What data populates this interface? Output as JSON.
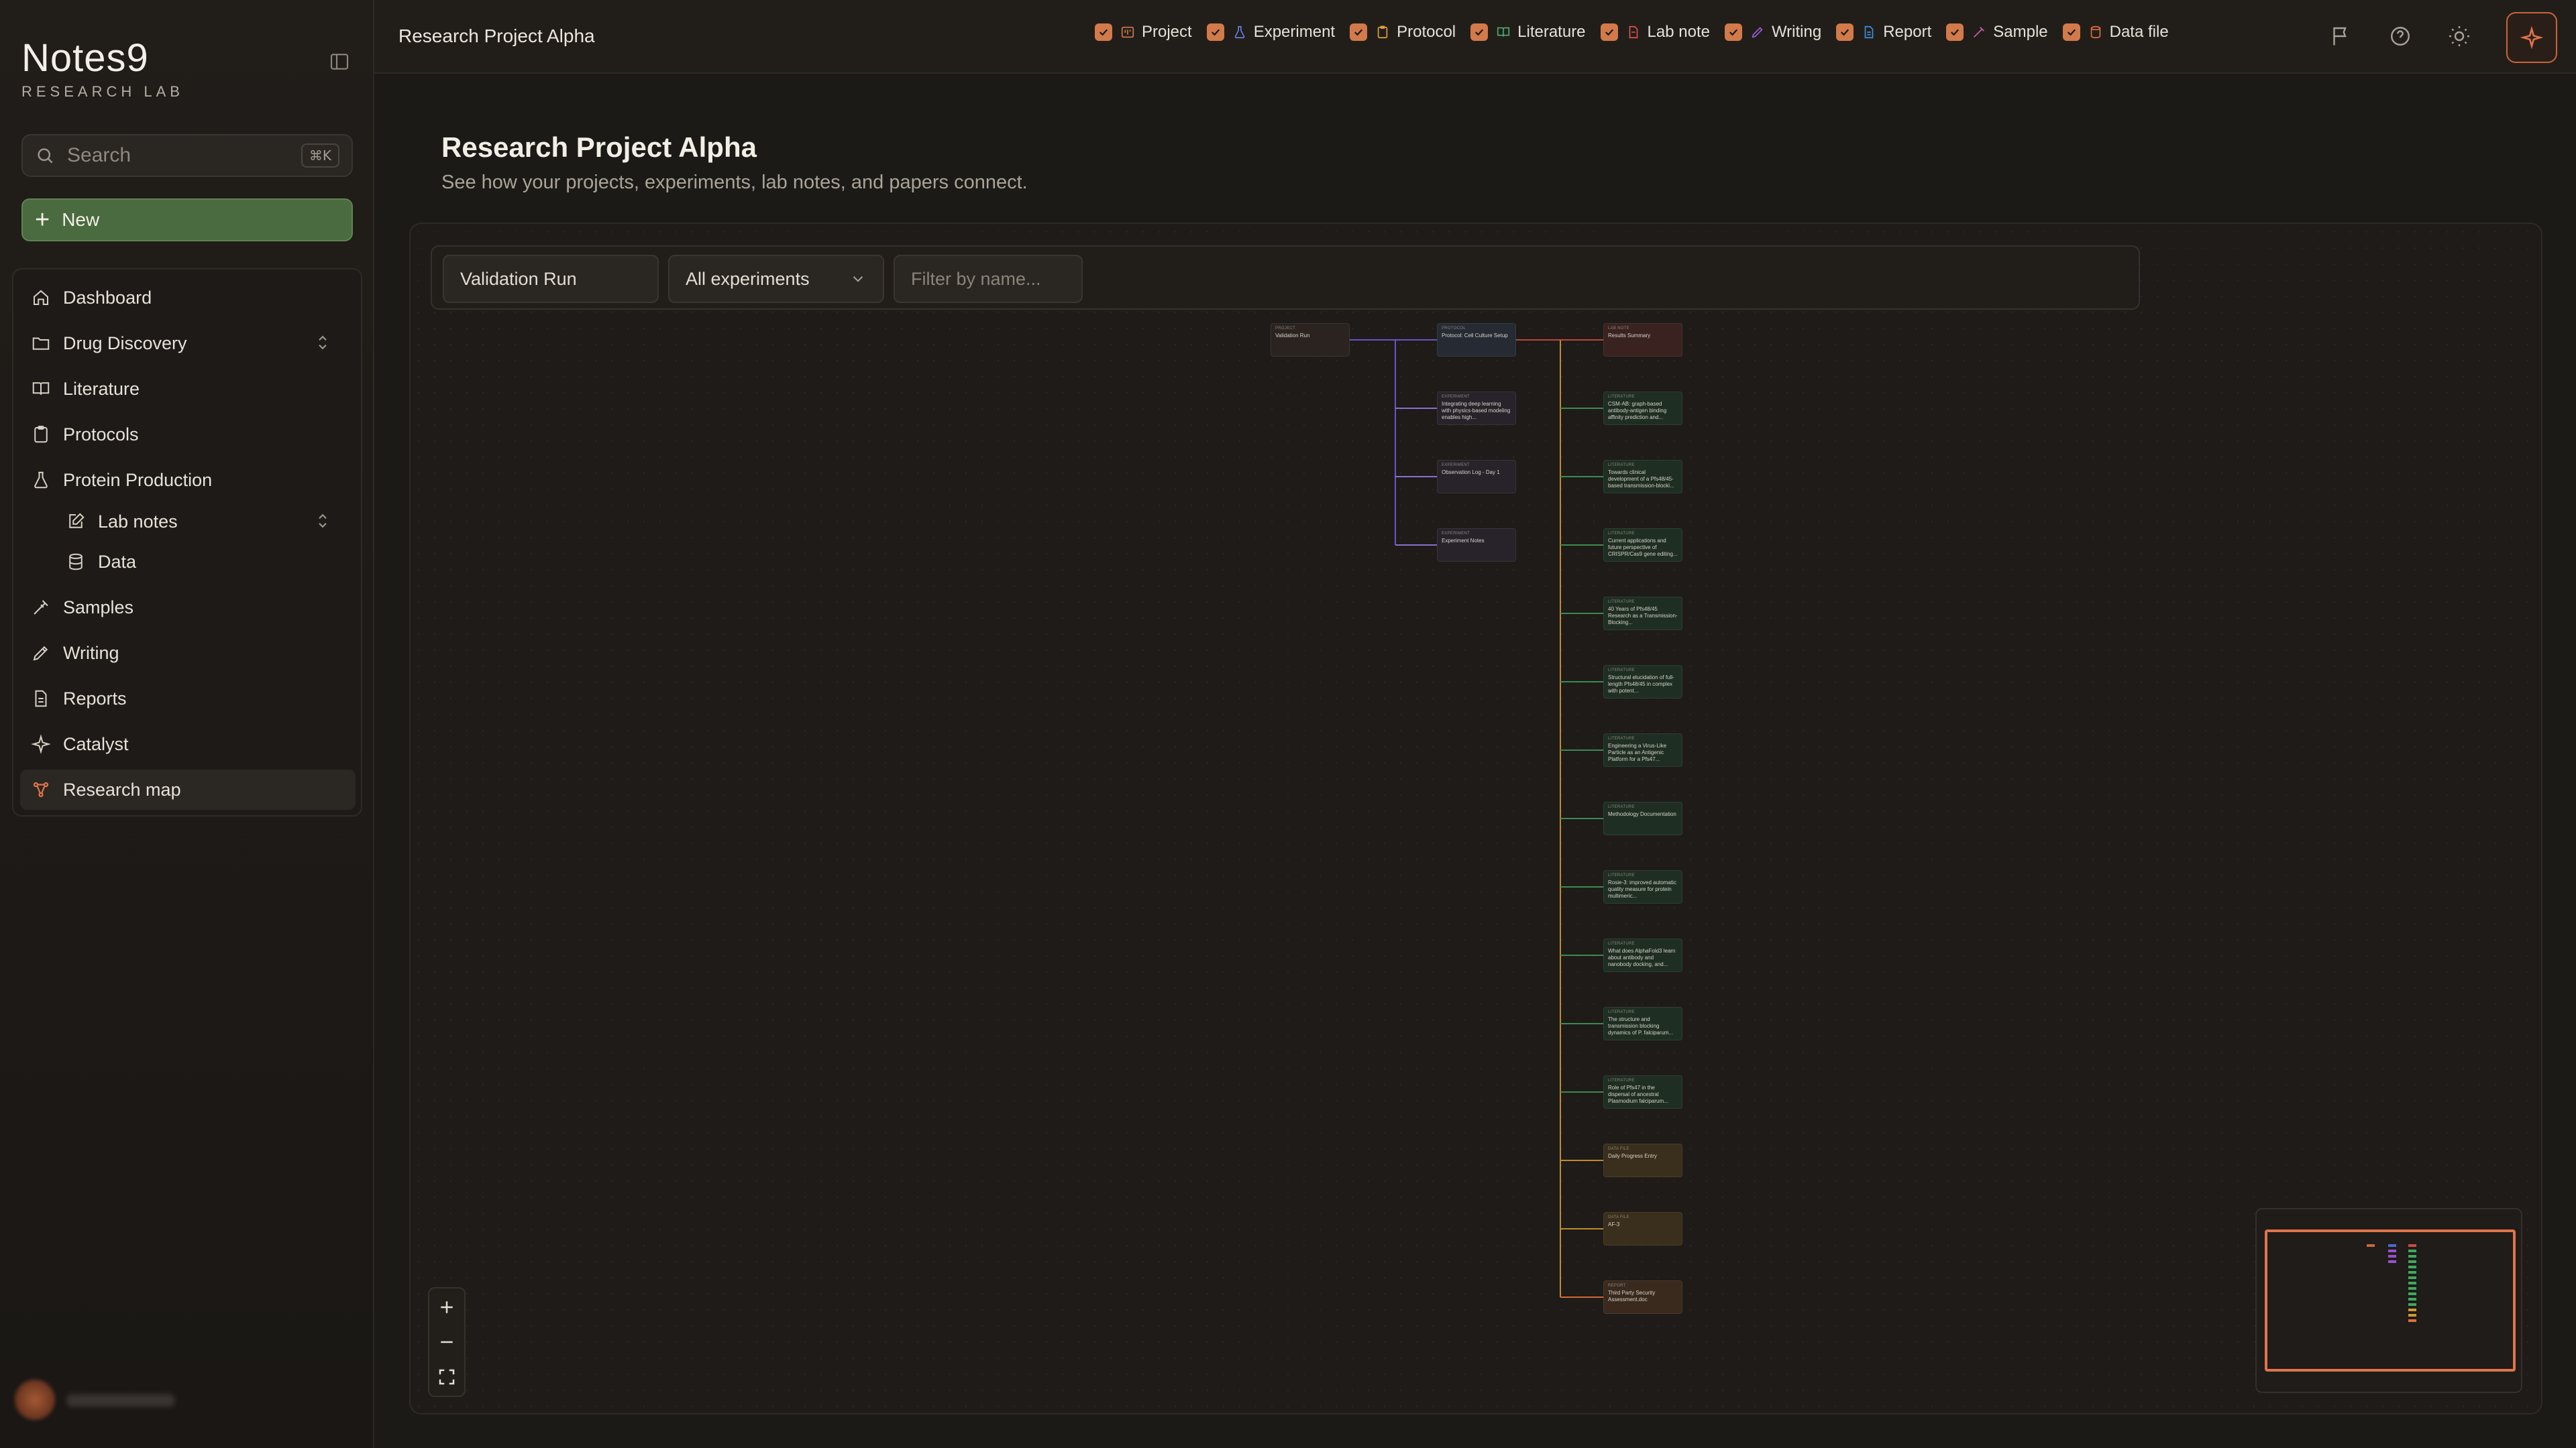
{
  "app": {
    "brand_name": "Notes9",
    "brand_sub": "RESEARCH LAB"
  },
  "sidebar": {
    "search_placeholder": "Search",
    "search_shortcut": "⌘K",
    "new_label": "New",
    "items": [
      {
        "label": "Dashboard",
        "icon": "home-icon"
      },
      {
        "label": "Drug Discovery",
        "icon": "folder-icon"
      },
      {
        "label": "Literature",
        "icon": "book-icon"
      },
      {
        "label": "Protocols",
        "icon": "clipboard-icon"
      },
      {
        "label": "Protein Production",
        "icon": "flask-icon"
      },
      {
        "label": "Lab notes",
        "icon": "note-edit-icon"
      },
      {
        "label": "Data",
        "icon": "database-icon"
      },
      {
        "label": "Samples",
        "icon": "pipette-icon"
      },
      {
        "label": "Writing",
        "icon": "pen-icon"
      },
      {
        "label": "Reports",
        "icon": "document-icon"
      },
      {
        "label": "Catalyst",
        "icon": "sparkle-icon"
      },
      {
        "label": "Research map",
        "icon": "network-icon"
      }
    ]
  },
  "topbar": {
    "title": "Research Project Alpha"
  },
  "main": {
    "title": "Research Project Alpha",
    "subtitle": "See how your projects, experiments, lab notes, and papers connect."
  },
  "toolbar": {
    "project_value": "Validation Run",
    "experiment_select": "All experiments",
    "filter_placeholder": "Filter by name...",
    "filters": [
      {
        "label": "Project",
        "checked": true,
        "color": "#d27a4a"
      },
      {
        "label": "Experiment",
        "checked": true,
        "color": "#6a7de0"
      },
      {
        "label": "Protocol",
        "checked": true,
        "color": "#e0a040"
      },
      {
        "label": "Literature",
        "checked": true,
        "color": "#4cb070"
      },
      {
        "label": "Lab note",
        "checked": true,
        "color": "#e05050"
      },
      {
        "label": "Writing",
        "checked": true,
        "color": "#a060e0"
      },
      {
        "label": "Report",
        "checked": true,
        "color": "#4090e0"
      },
      {
        "label": "Sample",
        "checked": true,
        "color": "#d060b0"
      },
      {
        "label": "Data file",
        "checked": true,
        "color": "#e07040"
      }
    ]
  },
  "graph": {
    "project_node": {
      "tag": "PROJECT",
      "title": "Validation Run"
    },
    "experiments": [
      {
        "tag": "PROTOCOL",
        "title": "Protocol: Cell Culture Setup"
      },
      {
        "tag": "EXPERIMENT",
        "title": "Integrating deep learning with physics-based modeling enables high..."
      },
      {
        "tag": "EXPERIMENT",
        "title": "Observation Log - Day 1"
      },
      {
        "tag": "EXPERIMENT",
        "title": "Experiment Notes"
      }
    ],
    "children": [
      {
        "tag": "LAB NOTE",
        "title": "Results Summary",
        "kind": "note"
      },
      {
        "tag": "LITERATURE",
        "title": "CSM-AB: graph-based antibody-antigen binding affinity prediction and...",
        "kind": "lit"
      },
      {
        "tag": "LITERATURE",
        "title": "Towards clinical development of a Pfs48/45-based transmission-blocki...",
        "kind": "lit"
      },
      {
        "tag": "LITERATURE",
        "title": "Current applications and future perspective of CRISPR/Cas9 gene editing...",
        "kind": "lit"
      },
      {
        "tag": "LITERATURE",
        "title": "40 Years of Pfs48/45 Research as a Transmission-Blocking...",
        "kind": "lit"
      },
      {
        "tag": "LITERATURE",
        "title": "Structural elucidation of full-length Pfs48/45 in complex with potent...",
        "kind": "lit"
      },
      {
        "tag": "LITERATURE",
        "title": "Engineering a Virus-Like Particle as an Antigenic Platform for a Pfs47...",
        "kind": "lit"
      },
      {
        "tag": "LITERATURE",
        "title": "Methodology Documentation",
        "kind": "lit"
      },
      {
        "tag": "LITERATURE",
        "title": "Rosie-3: improved automatic quality measure for protein multimeric...",
        "kind": "lit"
      },
      {
        "tag": "LITERATURE",
        "title": "What does AlphaFold3 learn about antibody and nanobody docking, and...",
        "kind": "lit"
      },
      {
        "tag": "LITERATURE",
        "title": "The structure and transmission blocking dynamics of P. falciparum...",
        "kind": "lit"
      },
      {
        "tag": "LITERATURE",
        "title": "Role of Pfs47 in the dispersal of ancestral Plasmodium falciparum...",
        "kind": "lit"
      },
      {
        "tag": "DATA FILE",
        "title": "Daily Progress Entry",
        "kind": "data"
      },
      {
        "tag": "DATA FILE",
        "title": "AF-3",
        "kind": "data"
      },
      {
        "tag": "REPORT",
        "title": "Third Party Security Assessment.doc",
        "kind": "report"
      }
    ]
  },
  "icons": {
    "collapse": "sidebar-collapse-icon",
    "flag": "flag-icon",
    "help": "help-circle-icon",
    "theme": "sun-icon",
    "ai": "sparkle-icon"
  }
}
